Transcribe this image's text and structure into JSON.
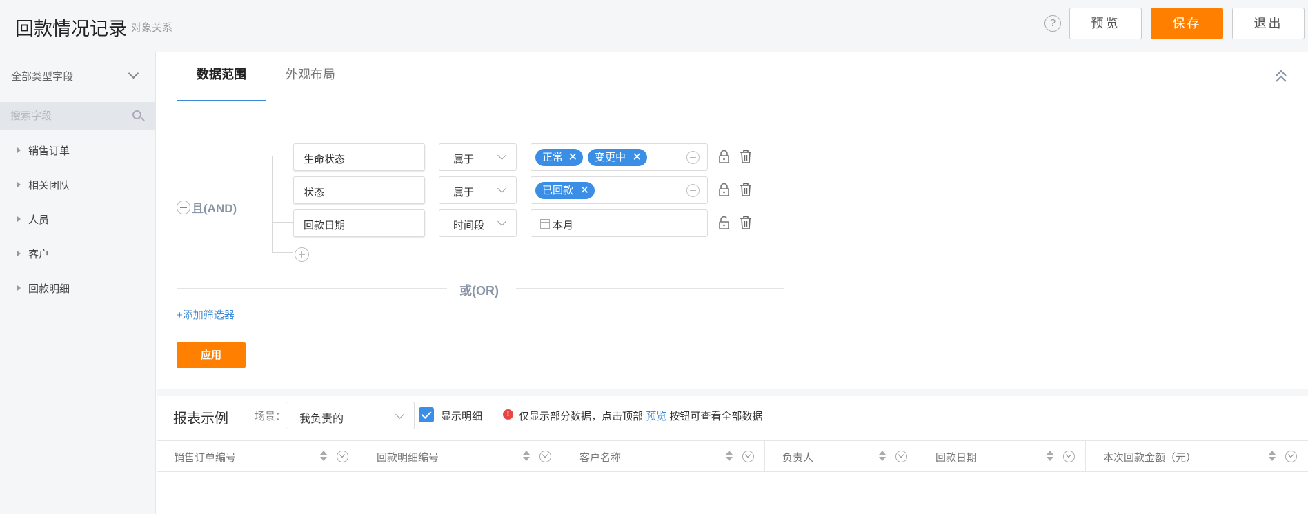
{
  "header": {
    "title": "回款情况记录",
    "subtitle": "对象关系",
    "help_icon": "?",
    "preview_label": "预览",
    "save_label": "保存",
    "exit_label": "退出"
  },
  "sidebar": {
    "field_type": "全部类型字段",
    "search_placeholder": "搜索字段",
    "items": [
      {
        "label": "销售订单"
      },
      {
        "label": "相关团队"
      },
      {
        "label": "人员"
      },
      {
        "label": "客户"
      },
      {
        "label": "回款明细"
      }
    ]
  },
  "tabs": [
    {
      "label": "数据范围",
      "active": true
    },
    {
      "label": "外观布局",
      "active": false
    }
  ],
  "filter": {
    "and_label": "且(AND)",
    "conditions": [
      {
        "field": "生命状态",
        "operator": "属于",
        "tags": [
          "正常",
          "变更中"
        ],
        "value_text": ""
      },
      {
        "field": "状态",
        "operator": "属于",
        "tags": [
          "已回款"
        ],
        "value_text": ""
      },
      {
        "field": "回款日期",
        "operator": "时间段",
        "tags": [],
        "value_text": "本月"
      }
    ],
    "or_label": "或(OR)",
    "add_filter_label": "+添加筛选器",
    "apply_label": "应用"
  },
  "report": {
    "title": "报表示例",
    "scene_label": "场景：",
    "scene_value": "我负责的",
    "show_detail_label": "显示明细",
    "show_detail_checked": true,
    "notice_prefix": "仅显示部分数据，点击顶部",
    "notice_link": "预览",
    "notice_suffix": "按钮可查看全部数据",
    "columns": [
      "销售订单编号",
      "回款明细编号",
      "客户名称",
      "负责人",
      "回款日期",
      "本次回款金额（元）"
    ]
  },
  "colors": {
    "accent_orange": "#ff8000",
    "tag_blue": "#3a8ee6",
    "link_blue": "#3d8ad6",
    "warning_red": "#e84545"
  }
}
